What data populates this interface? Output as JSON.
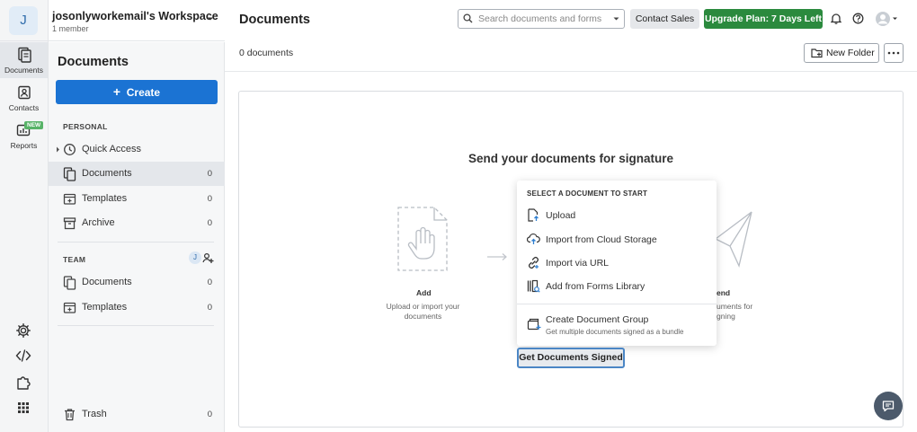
{
  "workspace": {
    "initial": "J",
    "name": "josonlyworkemail's Workspace",
    "members": "1 member"
  },
  "rail": [
    {
      "label": "Documents",
      "icon": "documents-icon"
    },
    {
      "label": "Contacts",
      "icon": "contacts-icon"
    },
    {
      "label": "Reports",
      "icon": "reports-icon",
      "badge": "NEW"
    }
  ],
  "rail_bottom_icons": [
    "settings-icon",
    "code-icon",
    "puzzle-icon",
    "apps-grid-icon"
  ],
  "sidebar": {
    "title": "Documents",
    "create_label": "Create",
    "personal_label": "PERSONAL",
    "personal": [
      {
        "label": "Quick Access",
        "count": ""
      },
      {
        "label": "Documents",
        "count": "0"
      },
      {
        "label": "Templates",
        "count": "0"
      },
      {
        "label": "Archive",
        "count": "0"
      }
    ],
    "team_label": "TEAM",
    "team_avatar": "J",
    "team": [
      {
        "label": "Documents",
        "count": "0"
      },
      {
        "label": "Templates",
        "count": "0"
      }
    ],
    "trash": {
      "label": "Trash",
      "count": "0"
    }
  },
  "header": {
    "title": "Documents",
    "search_placeholder": "Search documents and forms",
    "contact_sales": "Contact Sales",
    "upgrade": "Upgrade Plan: 7 Days Left"
  },
  "toolbar": {
    "count": "0 documents",
    "new_folder": "New Folder"
  },
  "main": {
    "heading": "Send your documents for signature",
    "step_add_title": "Add",
    "step_add_desc_1": "Upload or import your",
    "step_add_desc_2": "documents",
    "step_send_title": "end",
    "step_send_desc_1": "uments for",
    "step_send_desc_2": "gning",
    "cta": "Get Documents Signed"
  },
  "menu": {
    "heading": "SELECT A DOCUMENT TO START",
    "items": [
      "Upload",
      "Import from Cloud Storage",
      "Import via URL",
      "Add from Forms Library"
    ],
    "group_title": "Create Document Group",
    "group_sub": "Get multiple documents signed as a bundle"
  },
  "colors": {
    "primary": "#1b73d3",
    "upgrade": "#2b8a3e",
    "new_badge": "#58b368"
  }
}
